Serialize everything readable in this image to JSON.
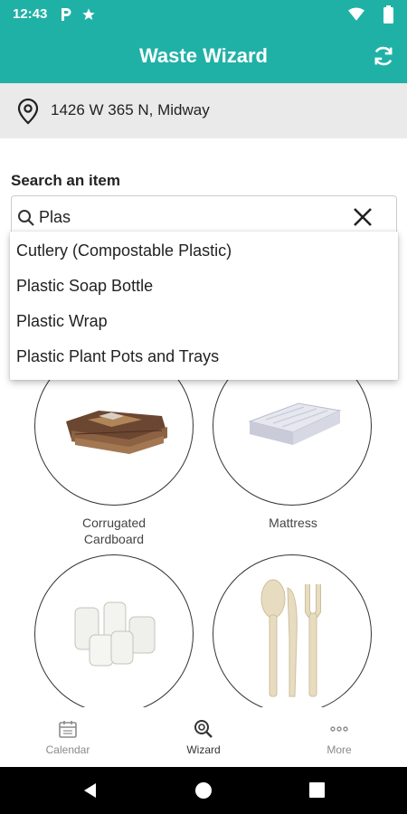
{
  "status_bar": {
    "time": "12:43",
    "icons": [
      "parking-icon",
      "star-icon",
      "wifi-icon",
      "battery-icon"
    ]
  },
  "app_bar": {
    "title": "Waste Wizard",
    "refresh_icon": "refresh-icon"
  },
  "address": {
    "text": "1426 W 365 N, Midway",
    "icon": "location-pin-icon"
  },
  "search": {
    "label": "Search an item",
    "value": "Plas",
    "suggestions": [
      "Cutlery (Compostable Plastic)",
      "Plastic Soap Bottle",
      "Plastic Wrap",
      "Plastic Plant Pots and Trays"
    ]
  },
  "tiles": [
    {
      "label": "Corrugated Cardboard",
      "label_line1": "Corrugated",
      "label_line2": "Cardboard",
      "image": "cardboard"
    },
    {
      "label": "Mattress",
      "image": "mattress"
    },
    {
      "label": "",
      "image": "glass-jars"
    },
    {
      "label": "",
      "image": "compostable-cutlery"
    }
  ],
  "bottom_nav": [
    {
      "label": "Calendar",
      "icon": "calendar-icon",
      "active": false
    },
    {
      "label": "Wizard",
      "icon": "wizard-search-icon",
      "active": true
    },
    {
      "label": "More",
      "icon": "more-dots-icon",
      "active": false
    }
  ],
  "colors": {
    "primary": "#20b1a6",
    "address_bg": "#eaeaea",
    "nav_inactive": "#8a8a8a",
    "nav_active": "#333333"
  }
}
